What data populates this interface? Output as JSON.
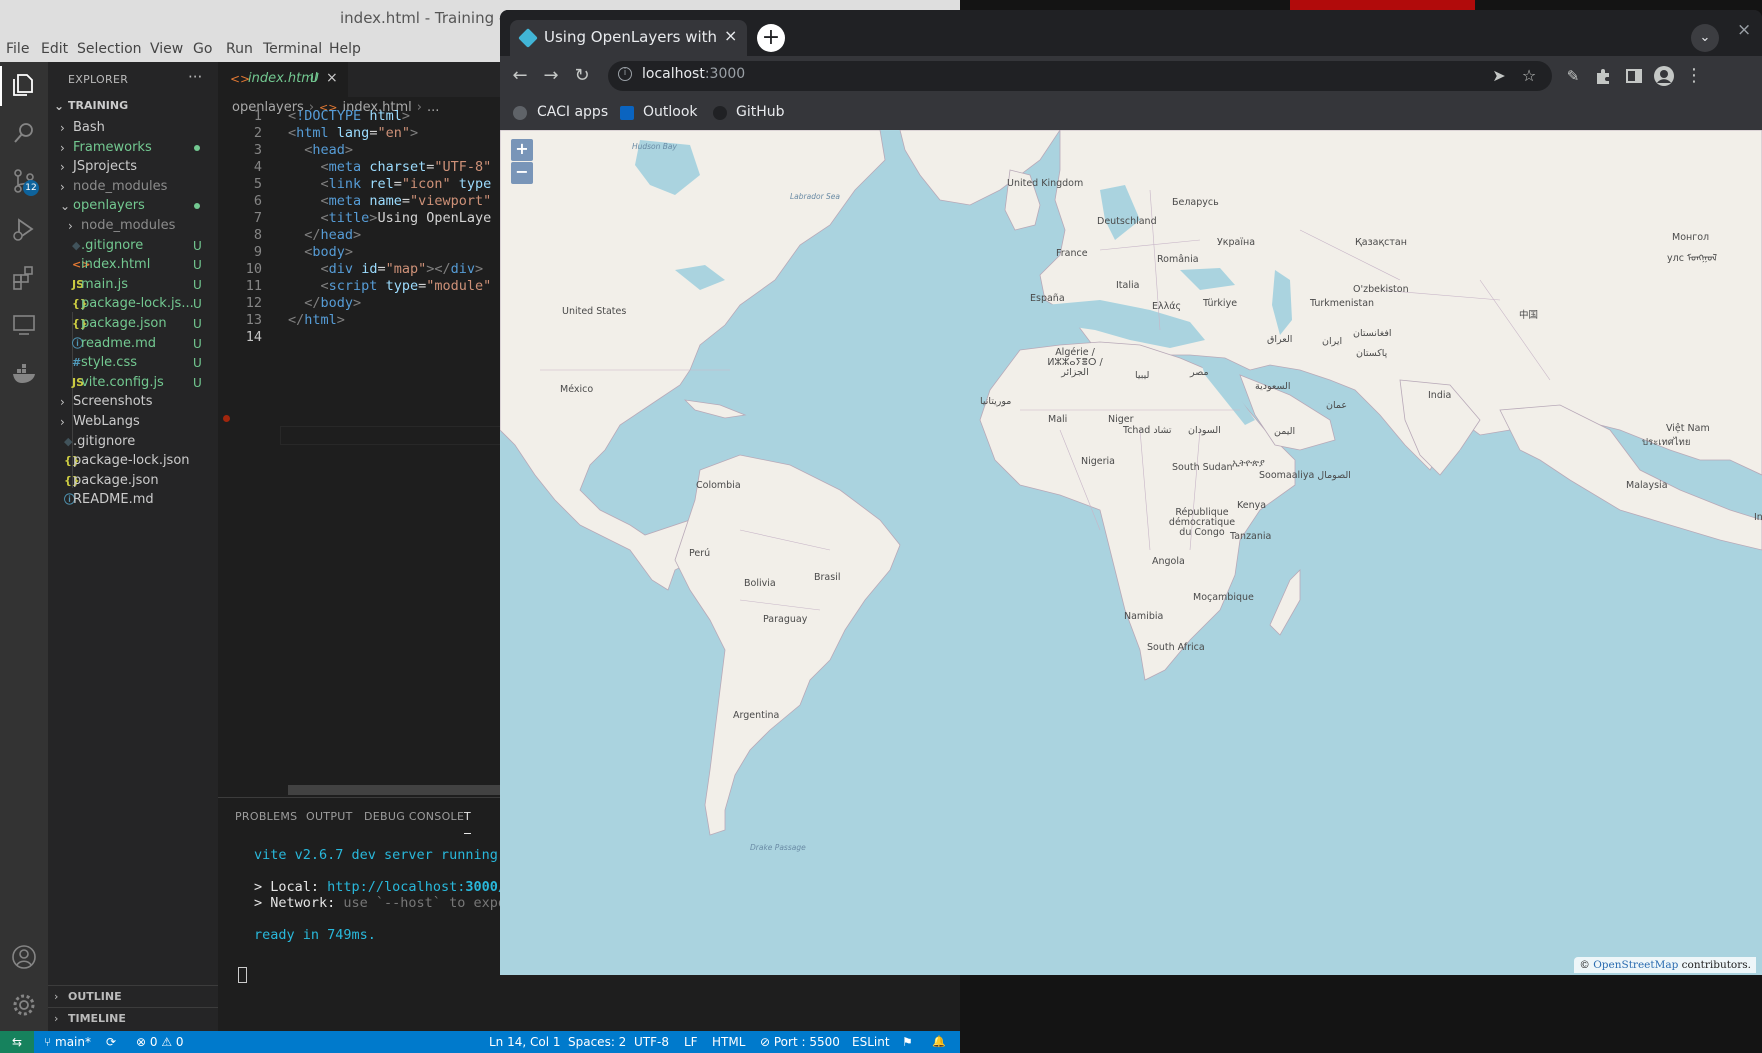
{
  "vscode": {
    "window_title": "index.html - Training - V",
    "menu": [
      "File",
      "Edit",
      "Selection",
      "View",
      "Go",
      "Run",
      "Terminal",
      "Help"
    ],
    "scm_badge": "12",
    "explorer_title": "EXPLORER",
    "explorer_more": "···",
    "workspace": "TRAINING",
    "tree": [
      {
        "name": "Bash",
        "type": "folder",
        "color": "#cccccc"
      },
      {
        "name": "Frameworks",
        "type": "folder",
        "color": "#73c991",
        "dot": true
      },
      {
        "name": "JSprojects",
        "type": "folder",
        "color": "#cccccc"
      },
      {
        "name": "node_modules",
        "type": "folder",
        "color": "#8c8c8c"
      },
      {
        "name": "openlayers",
        "type": "folder-open",
        "color": "#73c991",
        "dot": true
      },
      {
        "name": "node_modules",
        "type": "folder",
        "color": "#8c8c8c",
        "child": true
      },
      {
        "name": ".gitignore",
        "type": "file",
        "icon": "◆",
        "icon_color": "#41535b",
        "color": "#73c991",
        "status": "U",
        "child": true
      },
      {
        "name": "index.html",
        "type": "file",
        "icon": "<>",
        "icon_color": "#e37933",
        "color": "#73c991",
        "status": "U",
        "child": true
      },
      {
        "name": "main.js",
        "type": "file",
        "icon": "JS",
        "icon_color": "#cbcb41",
        "color": "#73c991",
        "status": "U",
        "child": true
      },
      {
        "name": "package-lock.js...",
        "type": "file",
        "icon": "{}",
        "icon_color": "#cbcb41",
        "color": "#73c991",
        "status": "U",
        "child": true
      },
      {
        "name": "package.json",
        "type": "file",
        "icon": "{}",
        "icon_color": "#cbcb41",
        "color": "#73c991",
        "status": "U",
        "child": true
      },
      {
        "name": "readme.md",
        "type": "file",
        "icon": "ⓘ",
        "icon_color": "#519aba",
        "color": "#73c991",
        "status": "U",
        "child": true
      },
      {
        "name": "style.css",
        "type": "file",
        "icon": "#",
        "icon_color": "#519aba",
        "color": "#73c991",
        "status": "U",
        "child": true
      },
      {
        "name": "vite.config.js",
        "type": "file",
        "icon": "JS",
        "icon_color": "#cbcb41",
        "color": "#73c991",
        "status": "U",
        "child": true
      },
      {
        "name": "Screenshots",
        "type": "folder",
        "color": "#cccccc"
      },
      {
        "name": "WebLangs",
        "type": "folder",
        "color": "#cccccc"
      },
      {
        "name": ".gitignore",
        "type": "file",
        "icon": "◆",
        "icon_color": "#41535b",
        "color": "#cccccc"
      },
      {
        "name": "package-lock.json",
        "type": "file",
        "icon": "{}",
        "icon_color": "#cbcb41",
        "color": "#cccccc"
      },
      {
        "name": "package.json",
        "type": "file",
        "icon": "{}",
        "icon_color": "#cbcb41",
        "color": "#cccccc"
      },
      {
        "name": "README.md",
        "type": "file",
        "icon": "ⓘ",
        "icon_color": "#519aba",
        "color": "#cccccc"
      }
    ],
    "outline_label": "OUTLINE",
    "timeline_label": "TIMELINE",
    "tab": {
      "icon": "<>",
      "label": "index.html",
      "status": "U",
      "close": "×"
    },
    "breadcrumb": [
      "openlayers",
      "index.html",
      "..."
    ],
    "code": [
      {
        "ln": "1",
        "tokens": [
          [
            "p",
            "<"
          ],
          [
            "k",
            "!DOCTYPE"
          ],
          [
            "t",
            " "
          ],
          [
            "a",
            "html"
          ],
          [
            "p",
            ">"
          ]
        ]
      },
      {
        "ln": "2",
        "tokens": [
          [
            "p",
            "<"
          ],
          [
            "k",
            "html"
          ],
          [
            "t",
            " "
          ],
          [
            "a",
            "lang"
          ],
          [
            "t",
            "="
          ],
          [
            "s",
            "\"en\""
          ],
          [
            "p",
            ">"
          ]
        ]
      },
      {
        "ln": "3",
        "tokens": [
          [
            "t",
            "  "
          ],
          [
            "p",
            "<"
          ],
          [
            "k",
            "head"
          ],
          [
            "p",
            ">"
          ]
        ]
      },
      {
        "ln": "4",
        "tokens": [
          [
            "t",
            "    "
          ],
          [
            "p",
            "<"
          ],
          [
            "k",
            "meta"
          ],
          [
            "t",
            " "
          ],
          [
            "a",
            "charset"
          ],
          [
            "t",
            "="
          ],
          [
            "s",
            "\"UTF-8\""
          ]
        ]
      },
      {
        "ln": "5",
        "tokens": [
          [
            "t",
            "    "
          ],
          [
            "p",
            "<"
          ],
          [
            "k",
            "link"
          ],
          [
            "t",
            " "
          ],
          [
            "a",
            "rel"
          ],
          [
            "t",
            "="
          ],
          [
            "s",
            "\"icon\""
          ],
          [
            "t",
            " "
          ],
          [
            "a",
            "type"
          ]
        ]
      },
      {
        "ln": "6",
        "tokens": [
          [
            "t",
            "    "
          ],
          [
            "p",
            "<"
          ],
          [
            "k",
            "meta"
          ],
          [
            "t",
            " "
          ],
          [
            "a",
            "name"
          ],
          [
            "t",
            "="
          ],
          [
            "s",
            "\"viewport\""
          ]
        ]
      },
      {
        "ln": "7",
        "tokens": [
          [
            "t",
            "    "
          ],
          [
            "p",
            "<"
          ],
          [
            "k",
            "title"
          ],
          [
            "p",
            ">"
          ],
          [
            "t",
            "Using OpenLaye"
          ]
        ]
      },
      {
        "ln": "8",
        "tokens": [
          [
            "t",
            "  "
          ],
          [
            "p",
            "</"
          ],
          [
            "k",
            "head"
          ],
          [
            "p",
            ">"
          ]
        ]
      },
      {
        "ln": "9",
        "tokens": [
          [
            "t",
            "  "
          ],
          [
            "p",
            "<"
          ],
          [
            "k",
            "body"
          ],
          [
            "p",
            ">"
          ]
        ]
      },
      {
        "ln": "10",
        "tokens": [
          [
            "t",
            "    "
          ],
          [
            "p",
            "<"
          ],
          [
            "k",
            "div"
          ],
          [
            "t",
            " "
          ],
          [
            "a",
            "id"
          ],
          [
            "t",
            "="
          ],
          [
            "s",
            "\"map\""
          ],
          [
            "p",
            "></"
          ],
          [
            "k",
            "div"
          ],
          [
            "p",
            ">"
          ]
        ]
      },
      {
        "ln": "11",
        "tokens": [
          [
            "t",
            "    "
          ],
          [
            "p",
            "<"
          ],
          [
            "k",
            "script"
          ],
          [
            "t",
            " "
          ],
          [
            "a",
            "type"
          ],
          [
            "t",
            "="
          ],
          [
            "s",
            "\"module\""
          ]
        ]
      },
      {
        "ln": "12",
        "tokens": [
          [
            "t",
            "  "
          ],
          [
            "p",
            "</"
          ],
          [
            "k",
            "body"
          ],
          [
            "p",
            ">"
          ]
        ]
      },
      {
        "ln": "13",
        "tokens": [
          [
            "p",
            "</"
          ],
          [
            "k",
            "html"
          ],
          [
            "p",
            ">"
          ]
        ]
      },
      {
        "ln": "14",
        "tokens": []
      }
    ],
    "panel_tabs": [
      "PROBLEMS",
      "OUTPUT",
      "DEBUG CONSOLE",
      "T"
    ],
    "terminal": {
      "line1": "vite v2.6.7 dev server running",
      "local_prefix": "> Local: ",
      "local_url": "http://localhost:",
      "local_port": "3000",
      "local_suffix": "/",
      "network_prefix": "> Network: ",
      "network_text": "use `--host` to expo",
      "ready": "ready in 749ms."
    },
    "status": {
      "remote": "⇆",
      "branch": "main*",
      "sync": "⟳",
      "problems": "⊗ 0 ⚠ 0",
      "position": "Ln 14, Col 1",
      "spaces": "Spaces: 2",
      "encoding": "UTF-8",
      "eol": "LF",
      "language": "HTML",
      "port": "⊘ Port : 5500",
      "eslint": "ESLint",
      "bell": "🔔"
    }
  },
  "browser": {
    "tab_title": "Using OpenLayers with Vite",
    "tab_close": "×",
    "new_tab": "+",
    "tab_search": "⌄",
    "window_close": "×",
    "url_host": "localhost",
    "url_port": ":3000",
    "bookmarks": [
      {
        "label": "CACI apps",
        "color": "#5f6368"
      },
      {
        "label": "Outlook",
        "color": "#0a64c0"
      },
      {
        "label": "GitHub",
        "color": "#202124"
      }
    ],
    "map": {
      "zoom_in": "+",
      "zoom_out": "−",
      "attribution_prefix": "© ",
      "attribution_link": "OpenStreetMap",
      "attribution_suffix": " contributors.",
      "country_labels": [
        "United Kingdom",
        "Беларусь",
        "Deutschland",
        "Україна",
        "Қазақстан",
        "Монгол",
        "улс ᠮᠣᠩᠭᠣᠯ",
        "France",
        "România",
        "Italia",
        "España",
        "Ελλάς",
        "Türkiye",
        "O'zbekiston",
        "Turkmenistan",
        "中国",
        "United States",
        "Algérie / ⵍⵣⵣⴰⵢⴻⵔ / الجزائر",
        "ليبيا",
        "مصر",
        "العراق",
        "ایران",
        "افغانستان",
        "پاکستان",
        "México",
        "موريتانيا",
        "Mali",
        "Niger",
        "Tchad تشاد",
        "السودان",
        "السعودية",
        "عمان",
        "India",
        "اليمن",
        "Việt Nam",
        "ประเทศไทย",
        "Nigeria",
        "South Sudan",
        "ኢትዮጵያ",
        "Soomaaliya الصومال",
        "Colombia",
        "Kenya",
        "République démocratique du Congo",
        "Tanzania",
        "Malaysia",
        "Perú",
        "Brasil",
        "Bolivia",
        "Angola",
        "Moçambique",
        "Paraguay",
        "Namibia",
        "South Africa",
        "Argentina",
        "Inc"
      ],
      "sea_labels": [
        "Hudson Bay",
        "Labrador Sea",
        "Drake Passage"
      ]
    }
  }
}
